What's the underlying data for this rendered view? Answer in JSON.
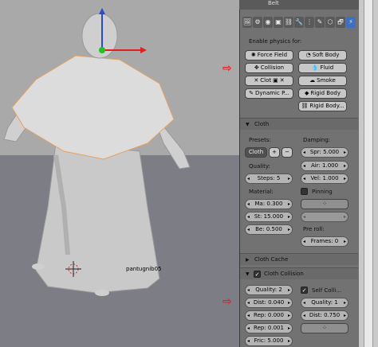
{
  "header": {
    "object_name": "Belt"
  },
  "viewport": {
    "object_label": "pantugnib05"
  },
  "tabs": [
    "🖼",
    "⚙",
    "◉",
    "▣",
    "⛓",
    "🔧",
    "⋮",
    "✎",
    "⬡",
    "🗗",
    "⚡"
  ],
  "physics": {
    "title": "Enable physics for:",
    "force_field": "Force Field",
    "soft_body": "Soft Body",
    "collision": "Collision",
    "fluid": "Fluid",
    "cloth": "Clot",
    "smoke": "Smoke",
    "dynamic_paint": "Dynamic P...",
    "rigid_body": "Rigid Body",
    "rigid_body_constraint": "Rigid Body..."
  },
  "cloth": {
    "header": "Cloth",
    "presets_label": "Presets:",
    "preset_value": "Cloth",
    "damping_label": "Damping:",
    "spring": "Spr: 5.000",
    "quality_label": "Quality:",
    "air": "Air: 1.000",
    "steps": "Steps:",
    "steps_value": "5",
    "vel": "Vel: 1.000",
    "material_label": "Material:",
    "pinning": "Pinning",
    "mass": "Ma: 0.300",
    "struct": "St: 15.000",
    "bending": "Be: 0.500",
    "preroll_label": "Pre roll:",
    "frames": "Frames: 0"
  },
  "cloth_cache": {
    "header": "Cloth Cache"
  },
  "cloth_collision": {
    "header": "Cloth Collision",
    "quality": "Quality:",
    "quality_value": "2",
    "self_collision": "Self Colli...",
    "dist": "Dist: 0.040",
    "self_quality": "Quality:",
    "self_quality_value": "1",
    "repel": "Rep: 0.000",
    "self_dist": "Dist: 0.750",
    "repel_dist": "Rep: 0.001",
    "friction": "Fric: 5.000"
  }
}
